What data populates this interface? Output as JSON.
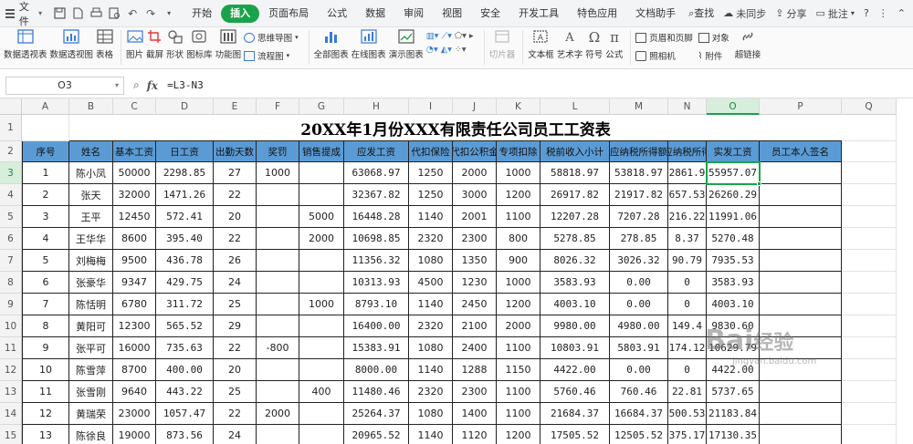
{
  "menubar": {
    "file_label": "文件",
    "tabs": [
      "开始",
      "插入",
      "页面布局",
      "公式",
      "数据",
      "审阅",
      "视图",
      "安全",
      "开发工具",
      "特色应用",
      "文档助手",
      "查找"
    ],
    "active_tab": "插入",
    "right": {
      "sync": "未同步",
      "share": "分享",
      "comment": "批注"
    }
  },
  "ribbon": {
    "items": [
      "数据透视表",
      "数据透视图",
      "表格",
      "图片",
      "截屏",
      "形状",
      "图标库",
      "功能图",
      "全部图表",
      "在线图表",
      "演示图表",
      "切片器",
      "文本框",
      "艺术字",
      "符号",
      "公式",
      "超链接"
    ],
    "mindmap": "思维导图",
    "flowchart": "流程图",
    "header_footer": "页眉和页脚",
    "object": "对象",
    "camera": "照相机",
    "attachment": "附件"
  },
  "formula_bar": {
    "name_box": "O3",
    "fx": "fx",
    "formula": "=L3-N3"
  },
  "columns": [
    "A",
    "B",
    "C",
    "D",
    "E",
    "F",
    "G",
    "H",
    "I",
    "J",
    "K",
    "L",
    "M",
    "N",
    "O",
    "P",
    "Q"
  ],
  "row_numbers": [
    "1",
    "2",
    "3",
    "4",
    "5",
    "6",
    "7",
    "8",
    "9",
    "10",
    "11",
    "12",
    "13",
    "14",
    "15"
  ],
  "sheet": {
    "title": "20XX年1月份XXX有限责任公司员工工资表",
    "headers": [
      "序号",
      "姓名",
      "基本工资",
      "日工资",
      "出勤天数",
      "奖罚",
      "销售提成",
      "应发工资",
      "代扣保险",
      "代扣公积金",
      "专项扣除",
      "税前收入小计",
      "应纳税所得额",
      "应纳税所得",
      "实发工资",
      "员工本人签名"
    ],
    "rows": [
      [
        "1",
        "陈小凤",
        "50000",
        "2298.85",
        "27",
        "1000",
        "",
        "63068.97",
        "1250",
        "2000",
        "1000",
        "58818.97",
        "53818.97",
        "2861.9",
        "55957.07",
        ""
      ],
      [
        "2",
        "张天",
        "32000",
        "1471.26",
        "22",
        "",
        "",
        "32367.82",
        "1250",
        "3000",
        "1200",
        "26917.82",
        "21917.82",
        "657.53",
        "26260.29",
        ""
      ],
      [
        "3",
        "王平",
        "12450",
        "572.41",
        "20",
        "",
        "5000",
        "16448.28",
        "1140",
        "2001",
        "1100",
        "12207.28",
        "7207.28",
        "216.22",
        "11991.06",
        ""
      ],
      [
        "4",
        "王华华",
        "8600",
        "395.40",
        "22",
        "",
        "2000",
        "10698.85",
        "2320",
        "2300",
        "800",
        "5278.85",
        "278.85",
        "8.37",
        "5270.48",
        ""
      ],
      [
        "5",
        "刘梅梅",
        "9500",
        "436.78",
        "26",
        "",
        "",
        "11356.32",
        "1080",
        "1350",
        "900",
        "8026.32",
        "3026.32",
        "90.79",
        "7935.53",
        ""
      ],
      [
        "6",
        "张豪华",
        "9347",
        "429.75",
        "24",
        "",
        "",
        "10313.93",
        "4500",
        "1230",
        "1000",
        "3583.93",
        "0.00",
        "0",
        "3583.93",
        ""
      ],
      [
        "7",
        "陈恬明",
        "6780",
        "311.72",
        "25",
        "",
        "1000",
        "8793.10",
        "1140",
        "2450",
        "1200",
        "4003.10",
        "0.00",
        "0",
        "4003.10",
        ""
      ],
      [
        "8",
        "黄阳可",
        "12300",
        "565.52",
        "29",
        "",
        "",
        "16400.00",
        "2320",
        "2100",
        "2000",
        "9980.00",
        "4980.00",
        "149.4",
        "9830.60",
        ""
      ],
      [
        "9",
        "张平可",
        "16000",
        "735.63",
        "22",
        "-800",
        "",
        "15383.91",
        "1080",
        "2400",
        "1100",
        "10803.91",
        "5803.91",
        "174.12",
        "10629.79",
        ""
      ],
      [
        "10",
        "陈雪萍",
        "8700",
        "400.00",
        "20",
        "",
        "",
        "8000.00",
        "1140",
        "1288",
        "1150",
        "4422.00",
        "0.00",
        "0",
        "4422.00",
        ""
      ],
      [
        "11",
        "张雪刚",
        "9640",
        "443.22",
        "25",
        "",
        "400",
        "11480.46",
        "2320",
        "2300",
        "1100",
        "5760.46",
        "760.46",
        "22.81",
        "5737.65",
        ""
      ],
      [
        "12",
        "黄瑞荣",
        "23000",
        "1057.47",
        "22",
        "2000",
        "",
        "25264.37",
        "1080",
        "1400",
        "1100",
        "21684.37",
        "16684.37",
        "500.53",
        "21183.84",
        ""
      ],
      [
        "13",
        "陈徐良",
        "19000",
        "873.56",
        "24",
        "",
        "",
        "20965.52",
        "1140",
        "1120",
        "1200",
        "17505.52",
        "12505.52",
        "375.17",
        "17130.35",
        ""
      ]
    ]
  },
  "selected_cell": "O3",
  "watermark": {
    "brand": "Bai",
    "brand2": "经验",
    "url": "jingyan.baidu.com"
  },
  "colors": {
    "accent": "#1aa34a",
    "header_fill": "#5b9bd5"
  }
}
